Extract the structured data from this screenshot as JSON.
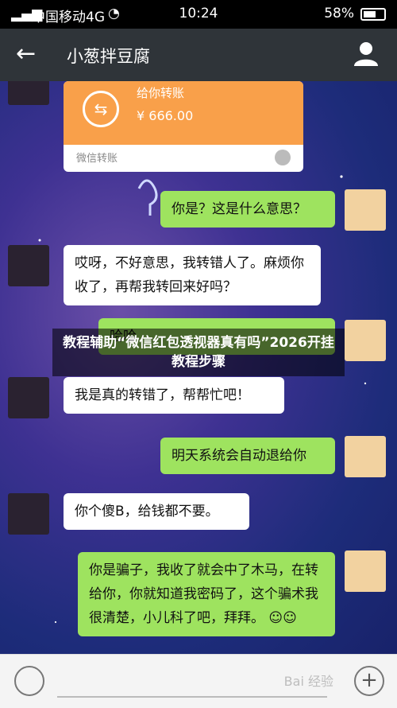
{
  "status_bar": {
    "carrier": "中国移动4G",
    "time": "10:24",
    "battery": "58%"
  },
  "header": {
    "title": "小葱拌豆腐",
    "back_icon": "arrow-left-icon",
    "profile_icon": "person-icon"
  },
  "transfer_card": {
    "label": "给你转账",
    "amount": "¥ 666.00",
    "footer": "微信转账"
  },
  "messages": [
    {
      "side": "right",
      "text": "你是？这是什么意思？"
    },
    {
      "side": "left",
      "text": "哎呀，不好意思，我转错人了。麻烦你收了，再帮我转回来好吗？"
    },
    {
      "side": "right",
      "text": "哈哈"
    },
    {
      "side": "left",
      "text": "我是真的转错了，帮帮忙吧！"
    },
    {
      "side": "right",
      "text": "明天系统会自动退给你"
    },
    {
      "side": "left",
      "text": "你个傻B，给钱都不要。"
    },
    {
      "side": "right",
      "text": "你是骗子，我收了就会中了木马，在转给你，你就知道我密码了，这个骗术我很清楚，小儿科了吧，拜拜。"
    }
  ],
  "overlay_text": "教程辅助“微信红包透视器真有吗”2026开挂教程步骤",
  "watermark": "Bai 经验"
}
